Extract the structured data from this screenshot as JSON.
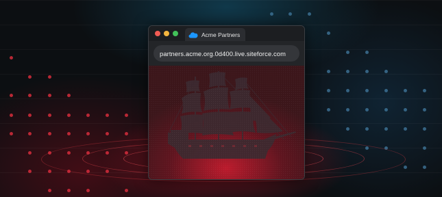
{
  "browser": {
    "tab": {
      "title": "Acme Partners",
      "icon": "cloud-icon"
    },
    "address_bar": {
      "url": "partners.acme.org.0d400.live.siteforce.com"
    }
  },
  "content": {
    "illustration": "pirate-ship-icon"
  },
  "colors": {
    "accent_red": "#d62d3c",
    "accent_blue": "#4682aa",
    "traffic_close": "#f25c54",
    "traffic_minimize": "#f4b63f",
    "traffic_zoom": "#42c25a",
    "favicon_blue": "#1b96ff"
  }
}
